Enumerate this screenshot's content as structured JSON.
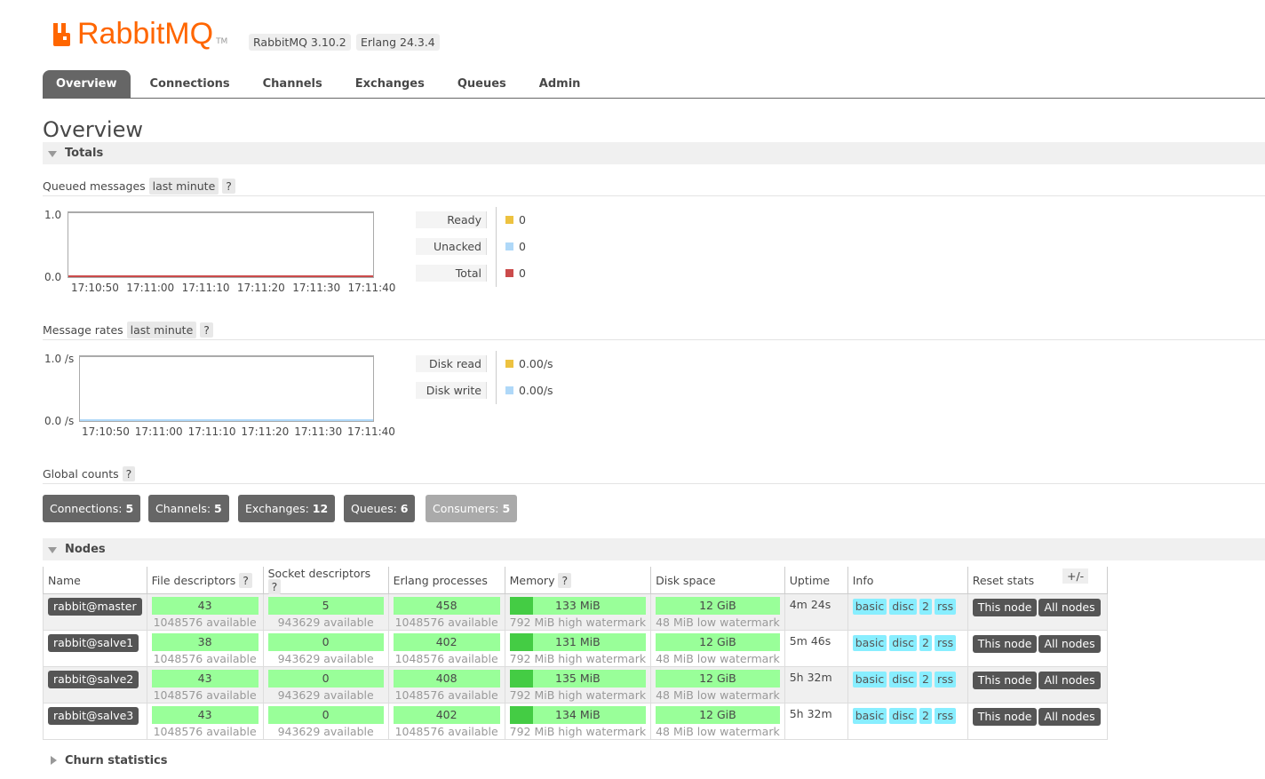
{
  "header": {
    "logo_text": "RabbitMQ",
    "logo_tm": "TM",
    "version_rabbit": "RabbitMQ 3.10.2",
    "version_erlang": "Erlang 24.3.4"
  },
  "tabs": [
    {
      "label": "Overview",
      "active": true
    },
    {
      "label": "Connections"
    },
    {
      "label": "Channels"
    },
    {
      "label": "Exchanges"
    },
    {
      "label": "Queues"
    },
    {
      "label": "Admin"
    }
  ],
  "page_title": "Overview",
  "totals": {
    "title": "Totals",
    "queued": {
      "label": "Queued messages",
      "range": "last minute",
      "help": "?",
      "y_top": "1.0",
      "y_bottom": "0.0",
      "x_ticks": [
        "17:10:50",
        "17:11:00",
        "17:11:10",
        "17:11:20",
        "17:11:30",
        "17:11:40"
      ],
      "legend": [
        {
          "name": "Ready",
          "value": "0",
          "color": "#edc240"
        },
        {
          "name": "Unacked",
          "value": "0",
          "color": "#afd8f8"
        },
        {
          "name": "Total",
          "value": "0",
          "color": "#cb4b4b"
        }
      ]
    },
    "rates": {
      "label": "Message rates",
      "range": "last minute",
      "help": "?",
      "y_top": "1.0 /s",
      "y_bottom": "0.0 /s",
      "x_ticks": [
        "17:10:50",
        "17:11:00",
        "17:11:10",
        "17:11:20",
        "17:11:30",
        "17:11:40"
      ],
      "legend": [
        {
          "name": "Disk read",
          "value": "0.00/s",
          "color": "#edc240"
        },
        {
          "name": "Disk write",
          "value": "0.00/s",
          "color": "#afd8f8"
        }
      ]
    },
    "global": {
      "label": "Global counts",
      "help": "?",
      "counts": [
        {
          "name": "Connections:",
          "value": "5"
        },
        {
          "name": "Channels:",
          "value": "5"
        },
        {
          "name": "Exchanges:",
          "value": "12"
        },
        {
          "name": "Queues:",
          "value": "6"
        },
        {
          "name": "Consumers:",
          "value": "5"
        }
      ]
    }
  },
  "nodes": {
    "title": "Nodes",
    "toggle": "+/-",
    "columns": [
      "Name",
      "File descriptors",
      "Socket descriptors",
      "Erlang processes",
      "Memory",
      "Disk space",
      "Uptime",
      "Info",
      "Reset stats"
    ],
    "help": "?",
    "rows": [
      {
        "name": "rabbit@master",
        "fd": "43",
        "fd_avail": "1048576 available",
        "sd": "5",
        "sd_avail": "943629 available",
        "ep": "458",
        "ep_avail": "1048576 available",
        "mem": "133 MiB",
        "mem_sub": "792 MiB high watermark",
        "disk": "12 GiB",
        "disk_sub": "48 MiB low watermark",
        "uptime": "4m 24s",
        "info": [
          "basic",
          "disc",
          "2",
          "rss"
        ],
        "reset": [
          "This node",
          "All nodes"
        ]
      },
      {
        "name": "rabbit@salve1",
        "fd": "38",
        "fd_avail": "1048576 available",
        "sd": "0",
        "sd_avail": "943629 available",
        "ep": "402",
        "ep_avail": "1048576 available",
        "mem": "131 MiB",
        "mem_sub": "792 MiB high watermark",
        "disk": "12 GiB",
        "disk_sub": "48 MiB low watermark",
        "uptime": "5m 46s",
        "info": [
          "basic",
          "disc",
          "2",
          "rss"
        ],
        "reset": [
          "This node",
          "All nodes"
        ]
      },
      {
        "name": "rabbit@salve2",
        "fd": "43",
        "fd_avail": "1048576 available",
        "sd": "0",
        "sd_avail": "943629 available",
        "ep": "408",
        "ep_avail": "1048576 available",
        "mem": "135 MiB",
        "mem_sub": "792 MiB high watermark",
        "disk": "12 GiB",
        "disk_sub": "48 MiB low watermark",
        "uptime": "5h 32m",
        "info": [
          "basic",
          "disc",
          "2",
          "rss"
        ],
        "reset": [
          "This node",
          "All nodes"
        ]
      },
      {
        "name": "rabbit@salve3",
        "fd": "43",
        "fd_avail": "1048576 available",
        "sd": "0",
        "sd_avail": "943629 available",
        "ep": "402",
        "ep_avail": "1048576 available",
        "mem": "134 MiB",
        "mem_sub": "792 MiB high watermark",
        "disk": "12 GiB",
        "disk_sub": "48 MiB low watermark",
        "uptime": "5h 32m",
        "info": [
          "basic",
          "disc",
          "2",
          "rss"
        ],
        "reset": [
          "This node",
          "All nodes"
        ]
      }
    ]
  },
  "churn": {
    "title": "Churn statistics"
  }
}
